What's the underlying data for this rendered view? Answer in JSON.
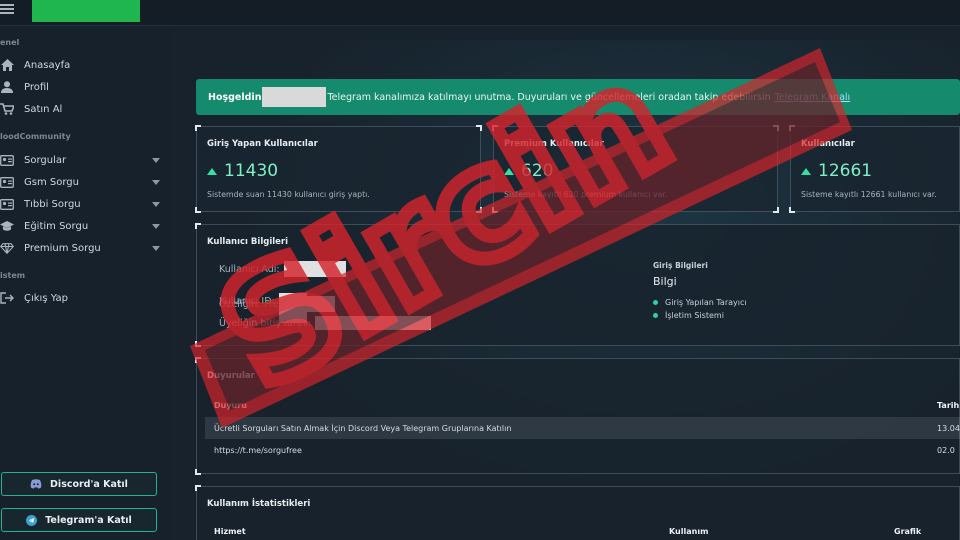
{
  "sidebar": {
    "sections": [
      {
        "title": "enel"
      },
      {
        "title": "loodCommunity"
      },
      {
        "title": "istem"
      }
    ],
    "items": [
      {
        "label": "Anasayfa",
        "icon": "home-icon"
      },
      {
        "label": "Profil",
        "icon": "user-icon"
      },
      {
        "label": "Satın Al",
        "icon": "cart-icon"
      },
      {
        "label": "Sorgular",
        "icon": "id-card-icon"
      },
      {
        "label": "Gsm Sorgu",
        "icon": "id-card-icon"
      },
      {
        "label": "Tıbbi Sorgu",
        "icon": "id-card-icon"
      },
      {
        "label": "Eğitim Sorgu",
        "icon": "graduation-cap-icon"
      },
      {
        "label": "Premium Sorgu",
        "icon": "diamond-icon"
      },
      {
        "label": "Çıkış Yap",
        "icon": "logout-icon"
      }
    ],
    "discord_button": "Discord'a Katıl",
    "telegram_button": "Telegram'a Katıl"
  },
  "banner": {
    "greeting": "Hoşgeldin",
    "message": "Telegram kanalımıza katılmayı unutma. Duyuruları ve güncellemeleri oradan takip edebilirsin",
    "link": "Telegram Kanalı"
  },
  "stats": [
    {
      "title": "Giriş Yapan Kullanıcılar",
      "value": "11430",
      "desc": "Sistemde suan 11430 kullanıcı giriş yaptı."
    },
    {
      "title": "Premium Kullanıcılar",
      "value": "620",
      "desc": "Sisteme kayıtlı 620 premium kullanıcı var."
    },
    {
      "title": "Kullanıcılar",
      "value": "12661",
      "desc": "Sisteme kayıtlı 12661 kullanıcı var."
    }
  ],
  "user_info": {
    "title": "Kullanıcı Bilgileri",
    "username_label": "Kullanıcı Adı:",
    "id_label": "Kullanıcı ID:",
    "feature_label": "Özeliğin:",
    "feature_value": "Fre",
    "expiry_label": "Üyeliğin bitiş tarihi:",
    "login_title": "Giriş Bilgileri",
    "login_value": "Bilgi",
    "login_items": [
      "Giriş Yapılan Tarayıcı",
      "İşletim Sistemi"
    ]
  },
  "announcements": {
    "title": "Duyurular",
    "col_announcement": "Duyuru",
    "col_date": "Tarih",
    "rows": [
      {
        "text": "Ücretli Sorguları Satın Almak İçin Discord Veya Telegram Gruplarına Katılın",
        "date": "13.04"
      },
      {
        "text": "https://t.me/sorgufree",
        "date": "02.0"
      }
    ]
  },
  "usage": {
    "title": "Kullanım İstatistikleri",
    "col_service": "Hizmet",
    "col_usage": "Kullanım",
    "col_graph": "Grafik"
  },
  "colors": {
    "accent": "#168a6c",
    "brand": "#1fb64f",
    "stat_value": "#7ff0c5",
    "stamp": "#d4242c"
  },
  "stamp": {
    "text": "Sircin"
  }
}
